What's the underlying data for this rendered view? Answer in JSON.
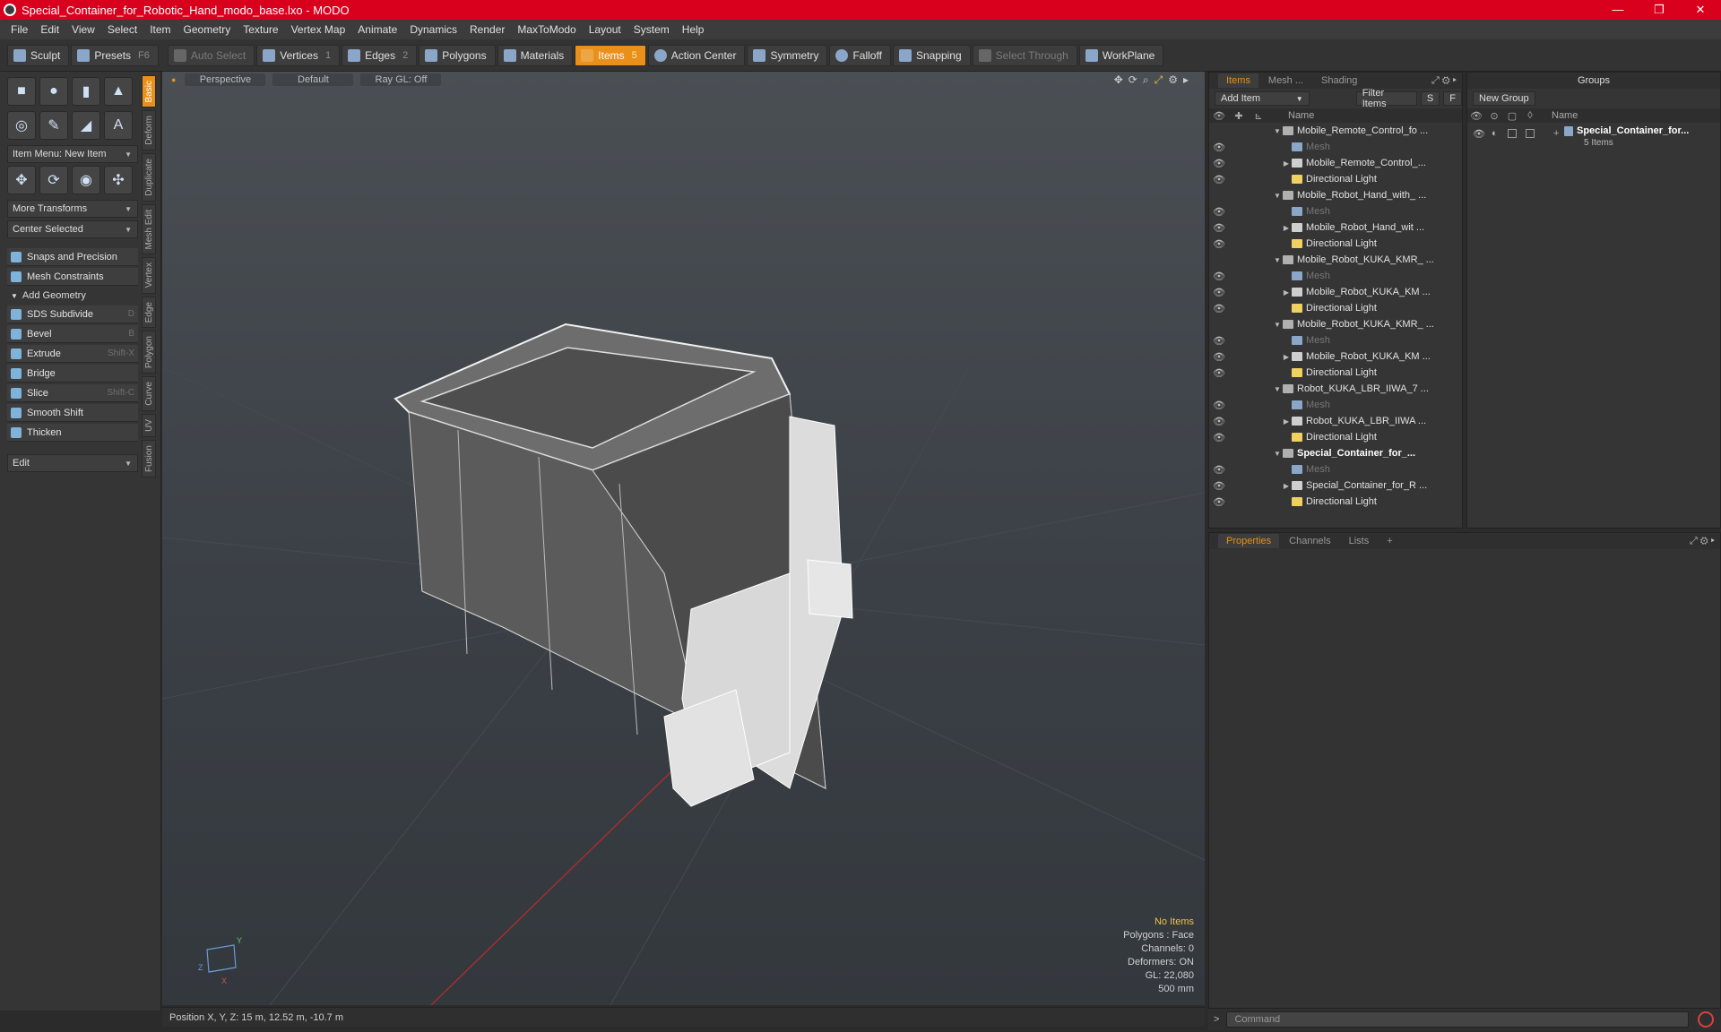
{
  "window": {
    "title": "Special_Container_for_Robotic_Hand_modo_base.lxo - MODO",
    "controls": [
      "—",
      "❐",
      "✕"
    ]
  },
  "menu": [
    "File",
    "Edit",
    "View",
    "Select",
    "Item",
    "Geometry",
    "Texture",
    "Vertex Map",
    "Animate",
    "Dynamics",
    "Render",
    "MaxToModo",
    "Layout",
    "System",
    "Help"
  ],
  "toolbar": {
    "sculpt": "Sculpt",
    "presets": "Presets",
    "presets_hotkey": "F6",
    "auto_select": "Auto Select",
    "vertices": "Vertices",
    "vertices_count": "1",
    "edges": "Edges",
    "edges_count": "2",
    "polygons": "Polygons",
    "materials": "Materials",
    "items": "Items",
    "items_count": "5",
    "action_center": "Action Center",
    "symmetry": "Symmetry",
    "falloff": "Falloff",
    "snapping": "Snapping",
    "select_through": "Select Through",
    "workplane": "WorkPlane"
  },
  "left_panel": {
    "item_menu": "Item Menu: New Item",
    "more_transforms": "More Transforms",
    "center_selected": "Center Selected",
    "snaps": "Snaps and Precision",
    "mesh_constraints": "Mesh Constraints",
    "add_geometry": "Add Geometry",
    "tools": [
      {
        "label": "SDS Subdivide",
        "hotkey": "D"
      },
      {
        "label": "Bevel",
        "hotkey": "B"
      },
      {
        "label": "Extrude",
        "hotkey": "Shift-X"
      },
      {
        "label": "Bridge",
        "hotkey": ""
      },
      {
        "label": "Slice",
        "hotkey": "Shift-C"
      },
      {
        "label": "Smooth Shift",
        "hotkey": ""
      },
      {
        "label": "Thicken",
        "hotkey": ""
      }
    ],
    "edit": "Edit",
    "vertical_tabs": [
      "Basic",
      "Deform",
      "Duplicate",
      "Mesh Edit",
      "Vertex",
      "Edge",
      "Polygon",
      "Curve",
      "UV",
      "Fusion"
    ]
  },
  "viewport": {
    "view": "Perspective",
    "shading": "Default",
    "raygl": "Ray GL: Off",
    "info": {
      "selection": "No Items",
      "polygons": "Polygons : Face",
      "channels": "Channels: 0",
      "deformers": "Deformers: ON",
      "gl": "GL: 22,080",
      "scale": "500 mm"
    },
    "axis_y": "Y",
    "axis_x": "X",
    "axis_z": "Z"
  },
  "status": {
    "position": "Position X, Y, Z:  15 m, 12.52 m, -10.7 m"
  },
  "items_panel": {
    "tabs": [
      "Items",
      "Mesh ...",
      "Shading"
    ],
    "add_item": "Add Item",
    "filter_items": "Filter Items",
    "s": "S",
    "f": "F",
    "name_col": "Name",
    "rows": [
      {
        "label": "Mobile_Remote_Control_fo ...",
        "kind": "scene"
      },
      {
        "label": "Mesh",
        "kind": "mesh"
      },
      {
        "label": "Mobile_Remote_Control_...",
        "kind": "group"
      },
      {
        "label": "Directional Light",
        "kind": "light"
      },
      {
        "label": "Mobile_Robot_Hand_with_ ...",
        "kind": "scene"
      },
      {
        "label": "Mesh",
        "kind": "mesh"
      },
      {
        "label": "Mobile_Robot_Hand_wit ...",
        "kind": "group"
      },
      {
        "label": "Directional Light",
        "kind": "light"
      },
      {
        "label": "Mobile_Robot_KUKA_KMR_ ...",
        "kind": "scene"
      },
      {
        "label": "Mesh",
        "kind": "mesh"
      },
      {
        "label": "Mobile_Robot_KUKA_KM ...",
        "kind": "group"
      },
      {
        "label": "Directional Light",
        "kind": "light"
      },
      {
        "label": "Mobile_Robot_KUKA_KMR_ ...",
        "kind": "scene"
      },
      {
        "label": "Mesh",
        "kind": "mesh"
      },
      {
        "label": "Mobile_Robot_KUKA_KM ...",
        "kind": "group"
      },
      {
        "label": "Directional Light",
        "kind": "light"
      },
      {
        "label": "Robot_KUKA_LBR_IIWA_7 ...",
        "kind": "scene"
      },
      {
        "label": "Mesh",
        "kind": "mesh"
      },
      {
        "label": "Robot_KUKA_LBR_IIWA ...",
        "kind": "group"
      },
      {
        "label": "Directional Light",
        "kind": "light"
      },
      {
        "label": "Special_Container_for_...",
        "kind": "scene-bold"
      },
      {
        "label": "Mesh",
        "kind": "mesh"
      },
      {
        "label": "Special_Container_for_R ...",
        "kind": "group"
      },
      {
        "label": "Directional Light",
        "kind": "light"
      }
    ]
  },
  "groups_panel": {
    "title": "Groups",
    "new_group": "New Group",
    "name_col": "Name",
    "group_name": "Special_Container_for...",
    "group_count": "5 Items"
  },
  "properties_panel": {
    "tabs": [
      "Properties",
      "Channels",
      "Lists"
    ],
    "add": "+"
  },
  "command": {
    "prompt": ">",
    "placeholder": "Command"
  },
  "colors": {
    "title_bar": "#d9001e",
    "accent": "#e8901a"
  }
}
